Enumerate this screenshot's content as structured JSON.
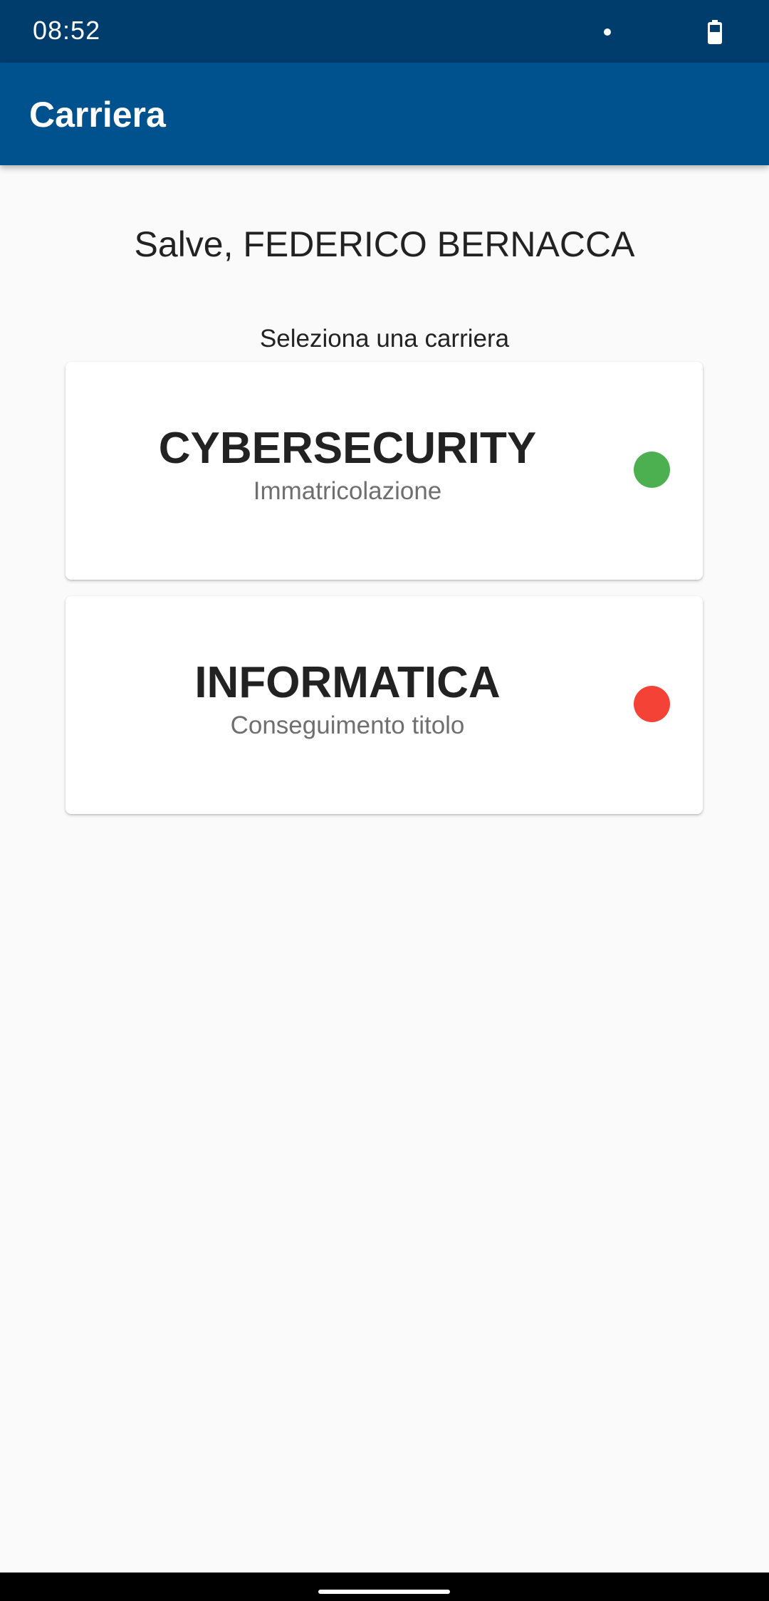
{
  "status_bar": {
    "time": "08:52",
    "icons": [
      "notification-dot",
      "battery-icon"
    ]
  },
  "app_bar": {
    "title": "Carriera",
    "color": "#00528f"
  },
  "main": {
    "greeting": "Salve, FEDERICO BERNACCA",
    "select_label": "Seleziona una carriera",
    "careers": [
      {
        "name": "CYBERSECURITY",
        "phase": "Immatricolazione",
        "status": "active",
        "status_color": "#4caf50"
      },
      {
        "name": "INFORMATICA",
        "phase": "Conseguimento titolo",
        "status": "inactive",
        "status_color": "#f44336"
      }
    ]
  }
}
